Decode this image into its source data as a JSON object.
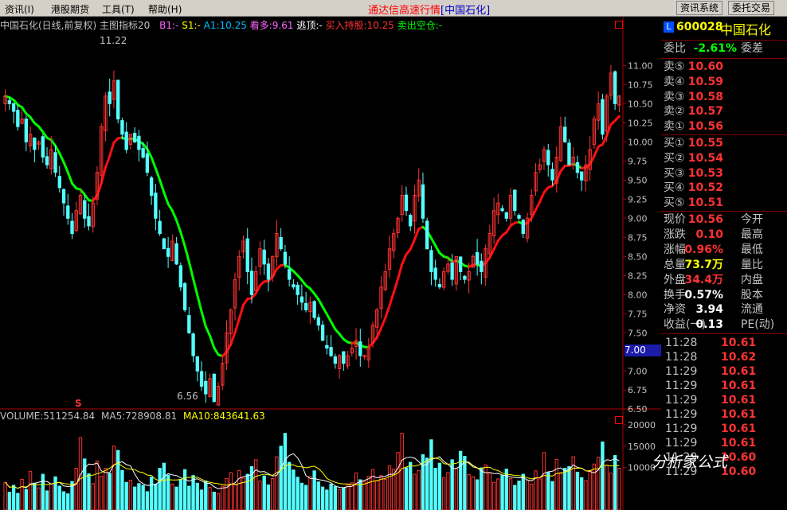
{
  "menu": {
    "items": [
      "资讯(I)",
      "港股期货",
      "工具(T)",
      "帮助(H)"
    ],
    "title": "通达信高速行情",
    "title_code": "[中国石化]",
    "btn_info": "资讯系统",
    "btn_trade": "委托交易"
  },
  "chart_header": {
    "name": "中国石化(日线,前复权)",
    "indicator": "主图指标20",
    "b1": "B1:-",
    "s1": "S1:-",
    "a1": "A1:10.25",
    "kanduo": "看多:9.61",
    "taoding": "逃顶:-",
    "buyhold": "买入持股:10.25",
    "sellempty": "卖出空仓:-"
  },
  "volume_header": {
    "volume": "VOLUME:511254.84",
    "ma5": "MA5:728908.81",
    "ma10": "MA10:843641.63"
  },
  "price_labels": {
    "high": "11.22",
    "low": "6.56",
    "current": "7.00",
    "s_marker": "S"
  },
  "chart_data": {
    "type": "candlestick",
    "y_ticks": [
      "11.00",
      "10.75",
      "10.50",
      "10.25",
      "10.00",
      "9.75",
      "9.50",
      "9.25",
      "9.00",
      "8.75",
      "8.50",
      "8.25",
      "8.00",
      "7.75",
      "7.50",
      "7.25",
      "7.00",
      "6.75",
      "6.50"
    ],
    "ylim": [
      6.44,
      11.41
    ],
    "vol_ticks": [
      "20000",
      "15000",
      "10000"
    ],
    "vol_ylim": [
      0,
      21500
    ],
    "closes": [
      10.6,
      10.5,
      10.4,
      10.2,
      10.3,
      10.0,
      10.1,
      9.9,
      10.0,
      9.8,
      9.7,
      9.9,
      9.6,
      9.4,
      9.2,
      9.0,
      8.8,
      9.1,
      9.3,
      9.0,
      8.9,
      9.2,
      9.6,
      10.2,
      10.6,
      10.5,
      10.8,
      10.3,
      10.1,
      9.9,
      10.1,
      10.0,
      9.9,
      9.8,
      9.6,
      9.3,
      9.0,
      8.8,
      8.6,
      8.5,
      8.7,
      8.4,
      8.1,
      7.8,
      7.5,
      7.2,
      7.0,
      6.8,
      6.7,
      6.9,
      6.6,
      6.8,
      7.1,
      7.5,
      7.8,
      8.2,
      8.5,
      8.7,
      8.3,
      8.0,
      8.3,
      8.6,
      8.4,
      8.2,
      8.5,
      8.8,
      8.6,
      8.4,
      8.2,
      8.1,
      8.0,
      7.9,
      7.8,
      7.9,
      7.7,
      7.6,
      7.4,
      7.3,
      7.2,
      7.1,
      7.2,
      7.1,
      7.2,
      7.3,
      7.4,
      7.2,
      7.2,
      7.3,
      7.6,
      7.8,
      8.1,
      8.3,
      8.6,
      8.8,
      9.0,
      9.3,
      9.1,
      8.9,
      9.3,
      9.5,
      9.0,
      8.6,
      8.3,
      8.2,
      8.1,
      8.3,
      8.4,
      8.2,
      8.5,
      8.3,
      8.2,
      8.3,
      8.5,
      8.4,
      8.3,
      8.6,
      8.8,
      9.1,
      9.2,
      9.1,
      9.0,
      9.3,
      9.1,
      9.0,
      8.8,
      9.0,
      9.3,
      9.6,
      9.7,
      9.9,
      9.7,
      9.5,
      9.8,
      10.2,
      10.0,
      9.7,
      9.8,
      9.6,
      9.5,
      9.7,
      9.9,
      10.3,
      10.5,
      10.1,
      10.6,
      10.9,
      10.5,
      10.6
    ],
    "volumes": [
      6500,
      4200,
      5800,
      3900,
      7200,
      4800,
      9100,
      6300,
      5200,
      8400,
      4500,
      6100,
      7800,
      5600,
      4300,
      3800,
      6700,
      9800,
      17000,
      12000,
      8500,
      6200,
      11500,
      7900,
      9800,
      8600,
      15000,
      14000,
      9300,
      6500,
      7000,
      5400,
      6200,
      5800,
      4300,
      7700,
      6100,
      9800,
      11000,
      8200,
      6100,
      5400,
      7200,
      9500,
      5600,
      8100,
      6300,
      4700,
      6800,
      5300,
      4200,
      3900,
      5600,
      7400,
      8800,
      6100,
      9300,
      7500,
      8400,
      10200,
      11800,
      6800,
      8000,
      5900,
      7400,
      12500,
      15000,
      18000,
      11200,
      9400,
      7700,
      6300,
      5800,
      7900,
      9200,
      6600,
      5400,
      4700,
      6100,
      5500,
      4800,
      5200,
      5900,
      6400,
      8700,
      7100,
      6600,
      7900,
      9500,
      6800,
      8100,
      7200,
      10400,
      9600,
      13500,
      18000,
      9900,
      11200,
      8400,
      9300,
      13000,
      12200,
      16500,
      9800,
      11000,
      7600,
      8800,
      11800,
      9700,
      13800,
      12600,
      8300,
      7800,
      7100,
      9900,
      10600,
      8700,
      6500,
      7300,
      8100,
      9600,
      7400,
      5800,
      6800,
      8400,
      7000,
      6100,
      9200,
      7300,
      13500,
      8800,
      6700,
      11900,
      8600,
      9800,
      10200,
      12500,
      8900,
      7600,
      6900,
      9300,
      10800,
      12400,
      16000,
      10500,
      8700,
      12800,
      9800
    ]
  },
  "quote": {
    "code": "600028",
    "name": "中国石化",
    "weibi_label": "委比",
    "weibi": "-2.61%",
    "weicha_label": "委差",
    "asks": [
      {
        "l": "卖⑤",
        "v": "10.60"
      },
      {
        "l": "卖④",
        "v": "10.59"
      },
      {
        "l": "卖③",
        "v": "10.58"
      },
      {
        "l": "卖②",
        "v": "10.57"
      },
      {
        "l": "卖①",
        "v": "10.56"
      }
    ],
    "bids": [
      {
        "l": "买①",
        "v": "10.55"
      },
      {
        "l": "买②",
        "v": "10.54"
      },
      {
        "l": "买③",
        "v": "10.53"
      },
      {
        "l": "买④",
        "v": "10.52"
      },
      {
        "l": "买⑤",
        "v": "10.51"
      }
    ],
    "stats": [
      {
        "l": "现价",
        "v": "10.56",
        "c": "#ff3232",
        "l2": "今开"
      },
      {
        "l": "涨跌",
        "v": "0.10",
        "c": "#ff3232",
        "l2": "最高"
      },
      {
        "l": "涨幅",
        "v": "0.96%",
        "c": "#ff3232",
        "l2": "最低"
      },
      {
        "l": "总量",
        "v": "73.7万",
        "c": "#ffff00",
        "l2": "量比"
      },
      {
        "l": "外盘",
        "v": "34.4万",
        "c": "#ff3232",
        "l2": "内盘"
      },
      {
        "l": "换手",
        "v": "0.57%",
        "c": "#ffffff",
        "l2": "股本"
      },
      {
        "l": "净资",
        "v": "3.94",
        "c": "#ffffff",
        "l2": "流通"
      },
      {
        "l": "收益(一)",
        "v": "0.13",
        "c": "#ffffff",
        "l2": "PE(动)"
      }
    ],
    "ticks": [
      {
        "t": "11:28",
        "p": "10.61"
      },
      {
        "t": "11:28",
        "p": "10.62"
      },
      {
        "t": "11:29",
        "p": "10.61"
      },
      {
        "t": "11:29",
        "p": "10.61"
      },
      {
        "t": "11:29",
        "p": "10.61"
      },
      {
        "t": "11:29",
        "p": "10.61"
      },
      {
        "t": "11:29",
        "p": "10.61"
      },
      {
        "t": "11:29",
        "p": "10.61"
      },
      {
        "t": "11:29",
        "p": "10.60"
      },
      {
        "t": "11:29",
        "p": "10.60"
      }
    ],
    "watermark": "分析家公式"
  }
}
